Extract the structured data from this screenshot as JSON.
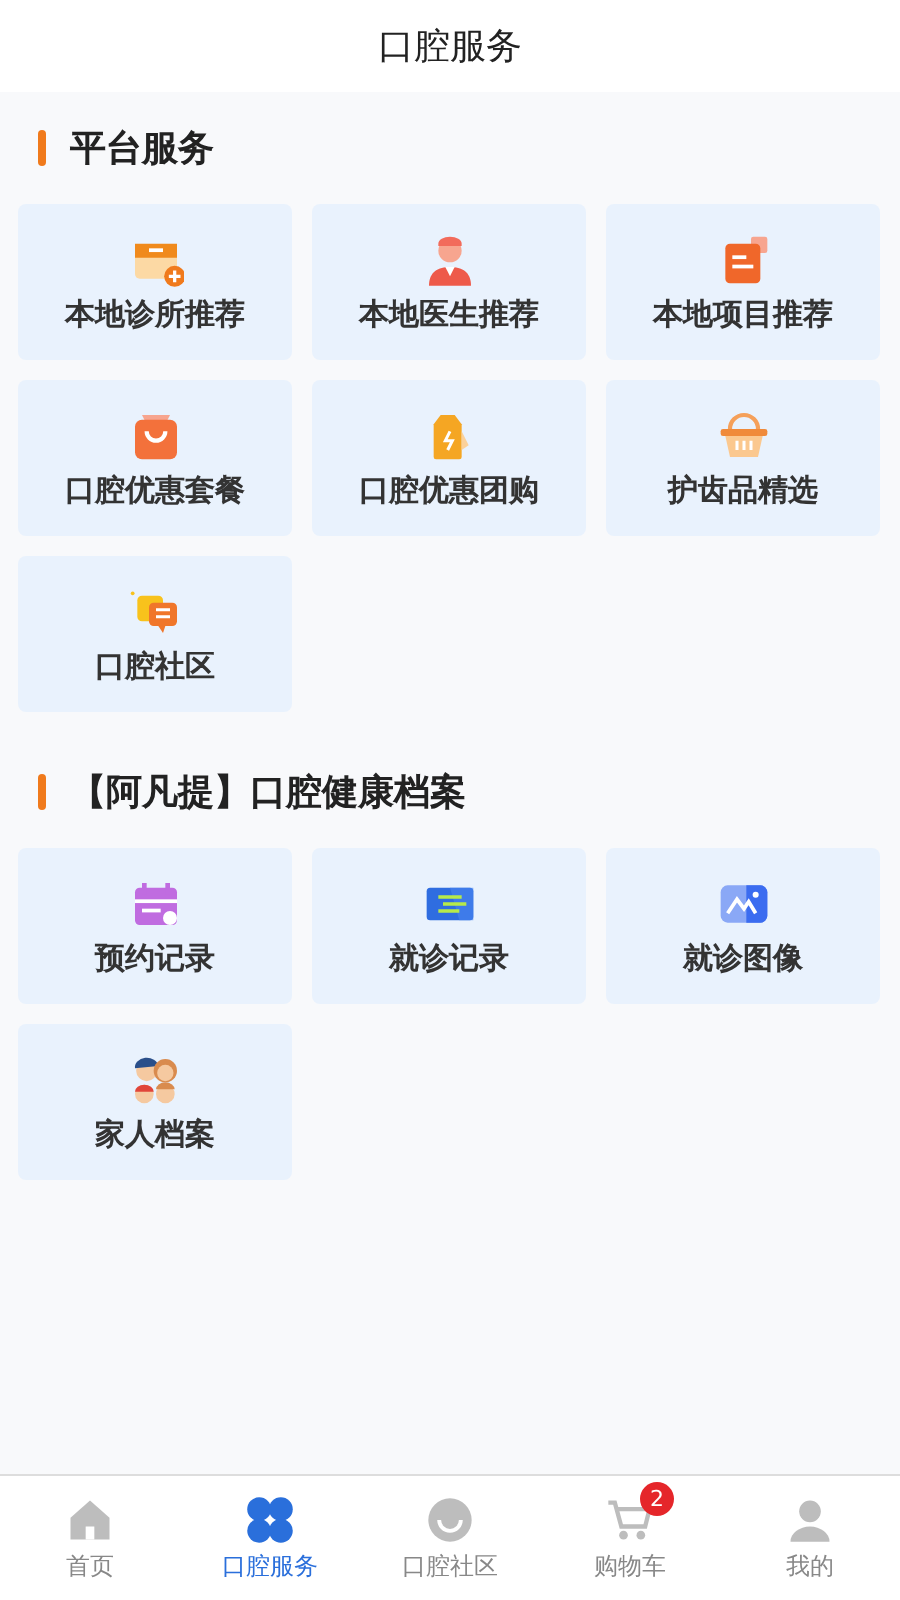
{
  "header": {
    "title": "口腔服务"
  },
  "sections": [
    {
      "title": "平台服务",
      "items": [
        {
          "label": "本地诊所推荐"
        },
        {
          "label": "本地医生推荐"
        },
        {
          "label": "本地项目推荐"
        },
        {
          "label": "口腔优惠套餐"
        },
        {
          "label": "口腔优惠团购"
        },
        {
          "label": "护齿品精选"
        },
        {
          "label": "口腔社区"
        }
      ]
    },
    {
      "title": "【阿凡提】口腔健康档案",
      "items": [
        {
          "label": "预约记录"
        },
        {
          "label": "就诊记录"
        },
        {
          "label": "就诊图像"
        },
        {
          "label": "家人档案"
        }
      ]
    }
  ],
  "tab_bar": [
    {
      "label": "首页",
      "selected": false
    },
    {
      "label": "口腔服务",
      "selected": true
    },
    {
      "label": "口腔社区",
      "selected": false
    },
    {
      "label": "购物车",
      "selected": false,
      "badge": "2"
    },
    {
      "label": "我的",
      "selected": false
    }
  ]
}
